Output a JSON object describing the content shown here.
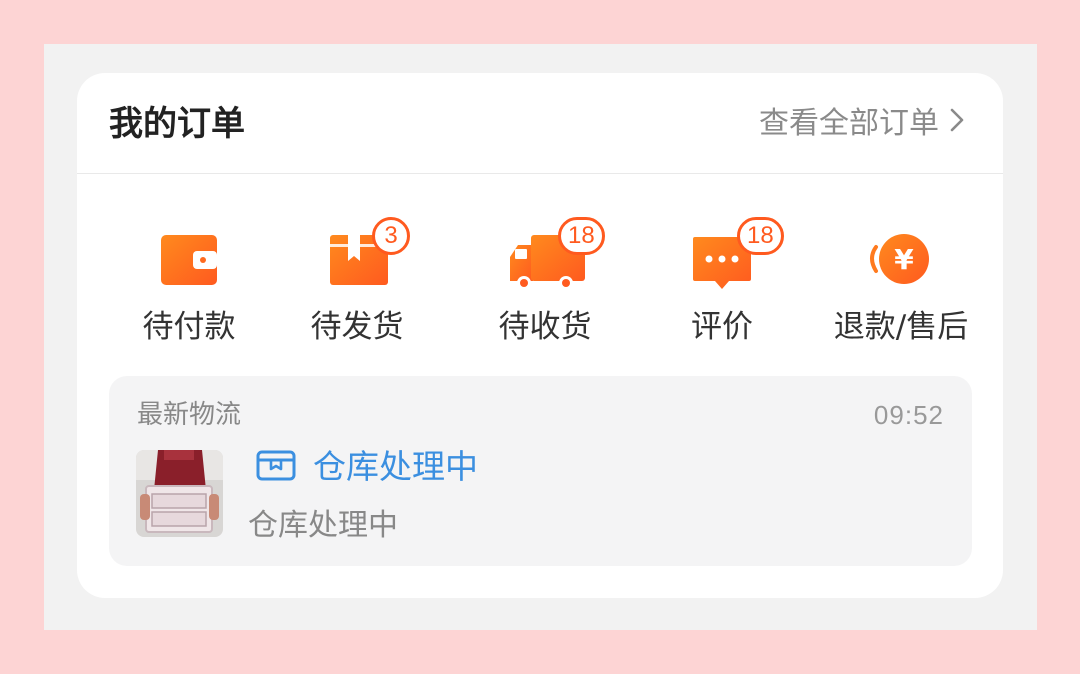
{
  "orders": {
    "title": "我的订单",
    "view_all": "查看全部订单",
    "statuses": [
      {
        "label": "待付款",
        "icon": "wallet-icon"
      },
      {
        "label": "待发货",
        "icon": "box-icon",
        "badge": "3"
      },
      {
        "label": "待收货",
        "icon": "truck-icon",
        "badge": "18"
      },
      {
        "label": "评价",
        "icon": "comment-icon",
        "badge": "18"
      },
      {
        "label": "退款/售后",
        "icon": "refund-icon"
      }
    ]
  },
  "logistics": {
    "title": "最新物流",
    "time": "09:52",
    "status": "仓库处理中",
    "description": "仓库处理中",
    "status_icon": "package-icon"
  },
  "colors": {
    "accent_orange": "#ff5a1f",
    "link_blue": "#3b8fe0"
  }
}
